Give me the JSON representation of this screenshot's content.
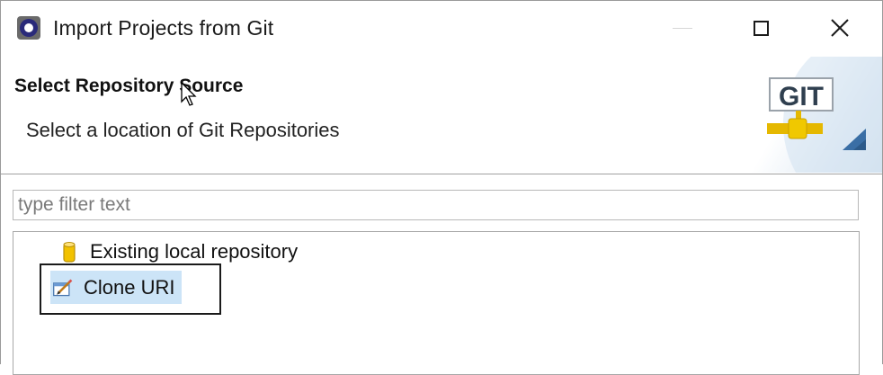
{
  "window": {
    "title": "Import Projects from Git",
    "icon": "eclipse-icon",
    "controls": [
      "minimize-icon",
      "maximize-icon",
      "close-icon"
    ]
  },
  "header": {
    "title": "Select Repository Source",
    "description": "Select a location of Git Repositories",
    "logo_text": "GIT"
  },
  "filter": {
    "placeholder": "type filter text",
    "value": ""
  },
  "tree": {
    "items": [
      {
        "label": "Existing local repository",
        "icon": "repository-icon",
        "selected": false
      },
      {
        "label": "Clone URI",
        "icon": "clone-uri-icon",
        "selected": true
      }
    ]
  },
  "colors": {
    "selection": "#cce4f7",
    "git_logo_green": "#2a8a2a",
    "git_logo_red": "#c02020",
    "git_logo_pipe": "#e5b800"
  }
}
